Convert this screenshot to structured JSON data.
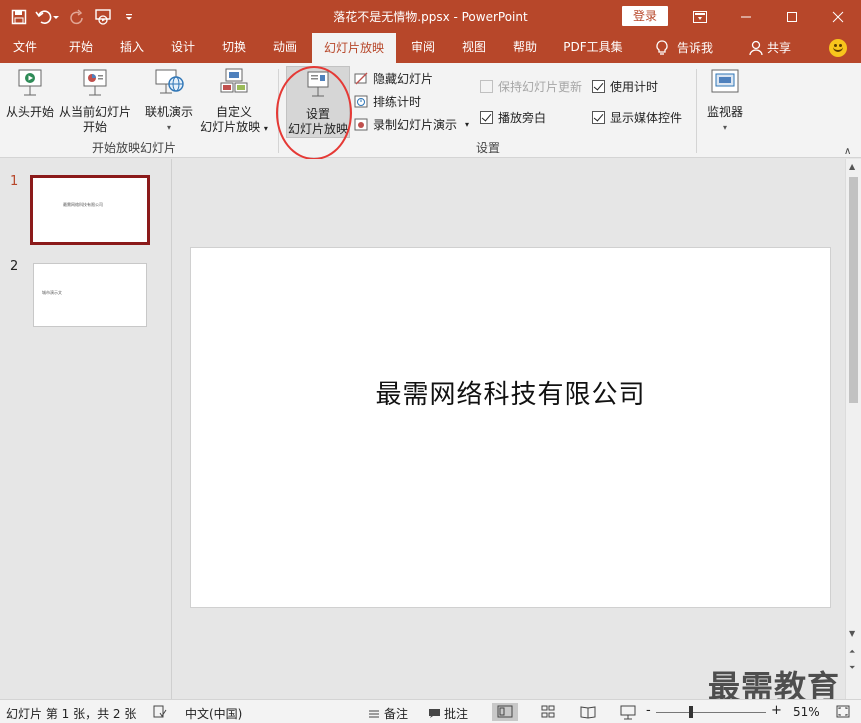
{
  "window": {
    "title": "落花不是无情物.ppsx - PowerPoint",
    "login_label": "登录"
  },
  "qat": {
    "items": [
      "save-icon",
      "undo-icon",
      "redo-icon",
      "present-from-start-icon",
      "customize-icon"
    ]
  },
  "tabs": [
    {
      "label": "文件",
      "active": false
    },
    {
      "label": "开始",
      "active": false
    },
    {
      "label": "插入",
      "active": false
    },
    {
      "label": "设计",
      "active": false
    },
    {
      "label": "切换",
      "active": false
    },
    {
      "label": "动画",
      "active": false
    },
    {
      "label": "幻灯片放映",
      "active": true
    },
    {
      "label": "审阅",
      "active": false
    },
    {
      "label": "视图",
      "active": false
    },
    {
      "label": "帮助",
      "active": false
    },
    {
      "label": "PDF工具集",
      "active": false
    },
    {
      "label": "告诉我",
      "active": false
    },
    {
      "label": "共享",
      "active": false
    }
  ],
  "ribbon": {
    "group_start": {
      "label": "开始放映幻灯片",
      "from_beginning": "从头开始",
      "from_current_line1": "从当前幻灯片",
      "from_current_line2": "开始",
      "online_present": "联机演示",
      "custom_line1": "自定义",
      "custom_line2": "幻灯片放映"
    },
    "group_setup": {
      "label": "设置",
      "setup_line1": "设置",
      "setup_line2": "幻灯片放映",
      "hide_slide": "隐藏幻灯片",
      "rehearse": "排练计时",
      "record": "录制幻灯片演示",
      "keep_updated": "保持幻灯片更新",
      "use_timings": "使用计时",
      "play_narrations": "播放旁白",
      "show_media": "显示媒体控件",
      "keep_updated_checked": false,
      "use_timings_checked": true,
      "play_narrations_checked": true,
      "show_media_checked": true
    },
    "group_monitors": {
      "label": "监视器"
    }
  },
  "thumbnails": [
    {
      "number": "1",
      "text": "最需网络科技有限公司",
      "selected": true
    },
    {
      "number": "2",
      "text": "城市演示文",
      "selected": false
    }
  ],
  "slide": {
    "title": "最需网络科技有限公司"
  },
  "status": {
    "slide_info": "幻灯片 第 1 张，共 2 张",
    "language": "中文(中国)",
    "notes": "备注",
    "comments": "批注",
    "zoom_level": "51%",
    "zoom_fraction": 0.51,
    "zoom_minus": "-",
    "zoom_plus": "+"
  },
  "watermark": "最需教育",
  "colors": {
    "accent": "#b7472a",
    "selected_thumb_border": "#8b1a1a",
    "annotation_circle": "#e53935"
  }
}
